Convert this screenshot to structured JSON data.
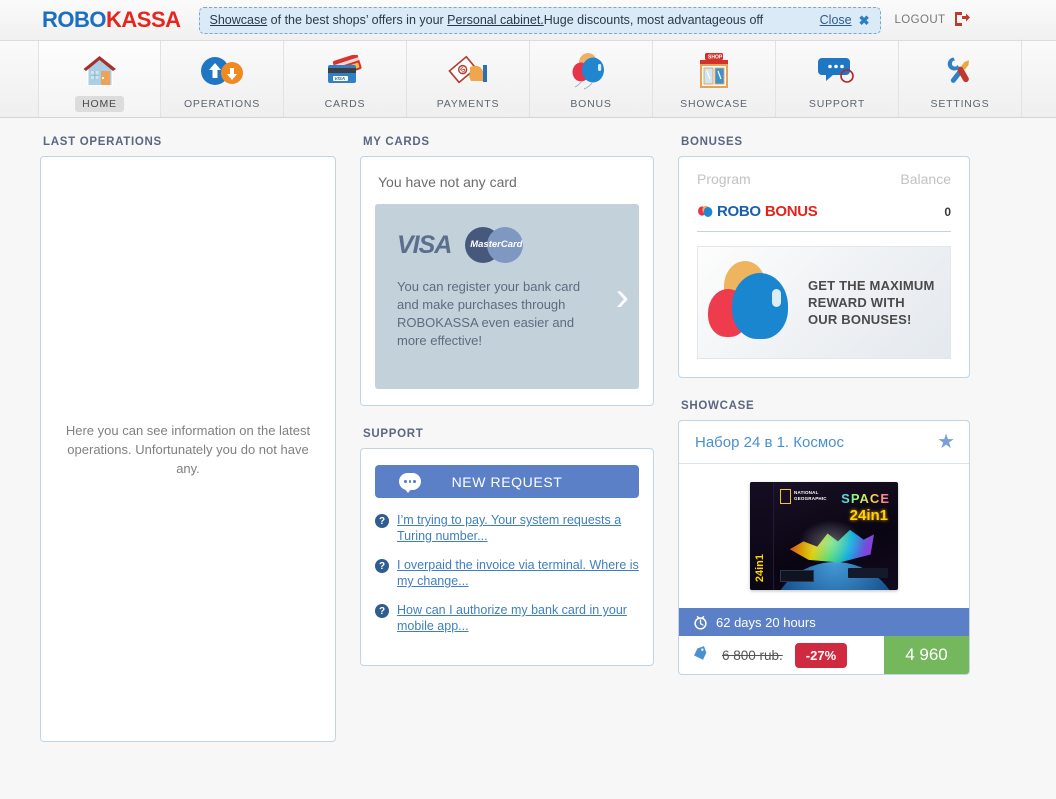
{
  "header": {
    "logo_robo": "ROBO",
    "logo_kassa": "KASSA",
    "promo": {
      "link1": "Showcase",
      "mid": " of the best shops’ offers in your ",
      "link2": "Personal cabinet.",
      "tail": "Huge discounts, most advantageous off",
      "close_label": "Close",
      "close_x": "✖"
    },
    "logout_label": "LOGOUT"
  },
  "nav": {
    "items": [
      {
        "label": "HOME",
        "icon": "house-icon",
        "active": true
      },
      {
        "label": "OPERATIONS",
        "icon": "arrows-updown-icon",
        "active": false
      },
      {
        "label": "CARDS",
        "icon": "bank-cards-icon",
        "active": false
      },
      {
        "label": "PAYMENTS",
        "icon": "money-hand-icon",
        "active": false
      },
      {
        "label": "BONUS",
        "icon": "balloons-icon",
        "active": false
      },
      {
        "label": "SHOWCASE",
        "icon": "shop-icon",
        "active": false
      },
      {
        "label": "SUPPORT",
        "icon": "chat-bubbles-icon",
        "active": false
      },
      {
        "label": "SETTINGS",
        "icon": "tools-icon",
        "active": false
      }
    ]
  },
  "last_operations": {
    "title": "LAST OPERATIONS",
    "empty_text": "Here you can see information on the latest operations. Unfortunately you do not have any."
  },
  "my_cards": {
    "title": "MY CARDS",
    "no_card_text": "You have not any card",
    "visa_label": "VISA",
    "mastercard_label": "MasterCard",
    "promo_text": "You can register your bank card and make purchases through ROBOKASSA even easier and more effective!",
    "arrow": "›"
  },
  "bonuses": {
    "title": "BONUSES",
    "col_program": "Program",
    "col_balance": "Balance",
    "program_name_1": "ROBO",
    "program_name_2": "BONUS",
    "balance": "0",
    "banner_line1": "GET THE MAXIMUM",
    "banner_line2": "REWARD WITH",
    "banner_line3": "OUR BONUSES!"
  },
  "support": {
    "title": "SUPPORT",
    "new_request_label": "NEW REQUEST",
    "faq": [
      "I’m trying to pay. Your system requests a Turing number...",
      "I overpaid the invoice via terminal. Where is my change...",
      "How can I authorize my bank card in your mobile app..."
    ]
  },
  "showcase": {
    "title": "SHOWCASE",
    "product_title": "Набор 24 в 1. Космос",
    "star": "★",
    "timer": "62 days 20 hours",
    "old_price": "6 800 rub.",
    "discount": "-27%",
    "new_price": "4 960",
    "box_brand_line1": "NATIONAL",
    "box_brand_line2": "GEOGRAPHIC",
    "box_word": "SPACE",
    "box_count": "24in1"
  },
  "colors": {
    "accent_blue": "#5b80c8",
    "link_blue": "#3f7fbf",
    "brand_blue": "#1a6fc4",
    "brand_red": "#e8251c",
    "green": "#74b75c",
    "red": "#cf2a3f",
    "panel_border": "#bfd4e4"
  }
}
